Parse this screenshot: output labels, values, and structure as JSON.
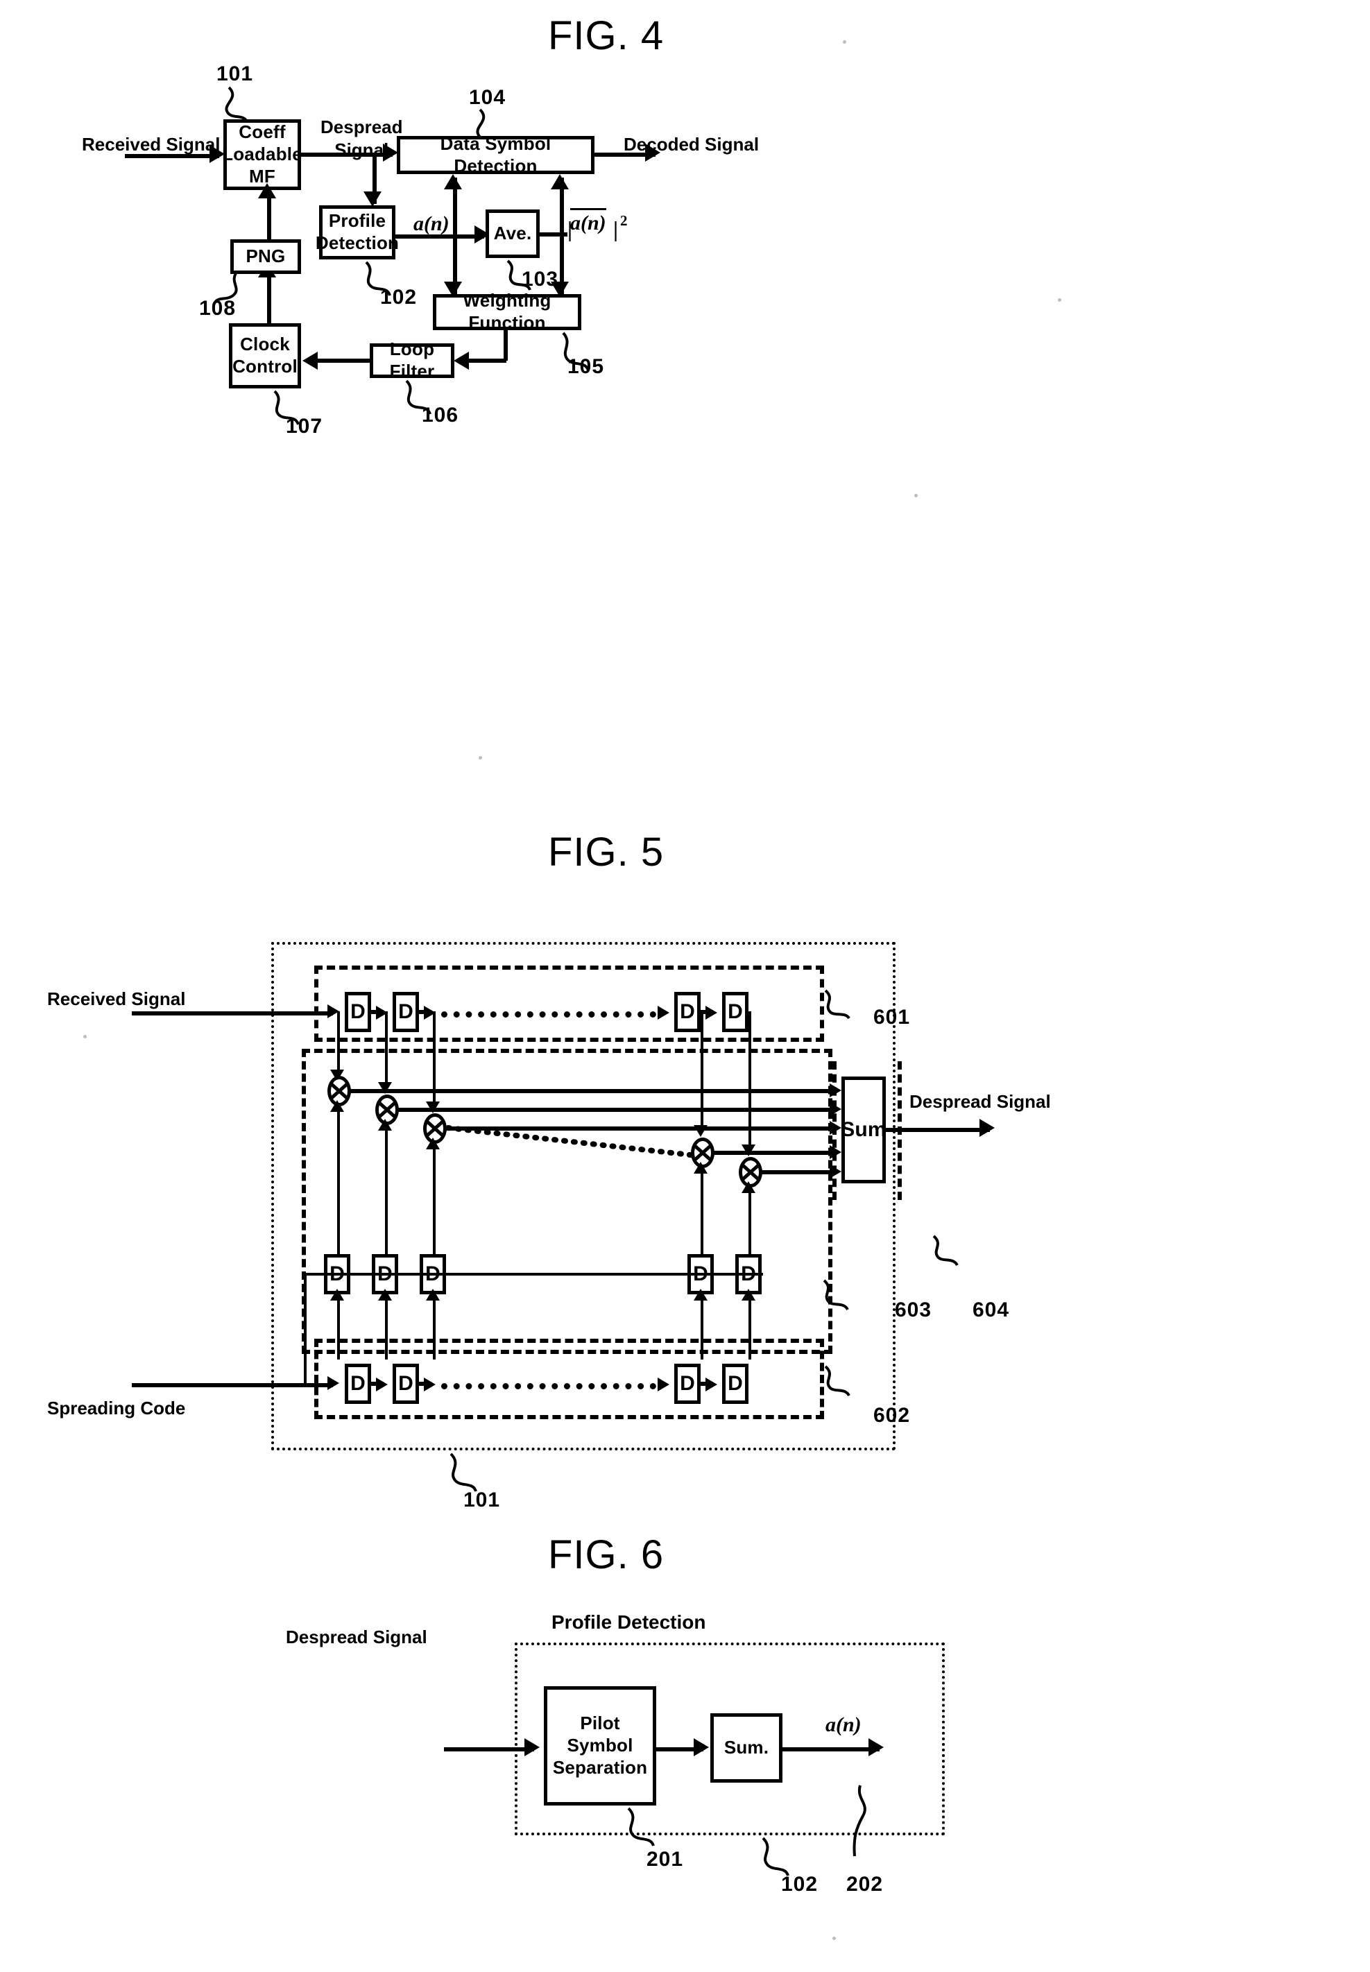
{
  "figures": [
    {
      "id": "fig4",
      "title": "FIG. 4",
      "blocks": [
        {
          "key": "coeff_mf",
          "label": "Coeff\nLoadable\nMF",
          "ref": "101"
        },
        {
          "key": "profile_det",
          "label": "Profile\nDetection",
          "ref": "102"
        },
        {
          "key": "ave",
          "label": "Ave.",
          "ref": "103"
        },
        {
          "key": "data_sym",
          "label": "Data Symbol Detection",
          "ref": "104"
        },
        {
          "key": "weighting",
          "label": "Weighting Function",
          "ref": "105"
        },
        {
          "key": "loop_filter",
          "label": "Loop Filter",
          "ref": "106"
        },
        {
          "key": "clock_ctrl",
          "label": "Clock\nControl",
          "ref": "107"
        },
        {
          "key": "png",
          "label": "PNG",
          "ref": "108"
        }
      ],
      "signals": {
        "received": "Received Signal",
        "despread": "Despread\nSignal",
        "decoded": "Decoded Signal",
        "a_of_n": "a(n)",
        "mag_sq": "|a(n)|",
        "mag_sq_exp": "2"
      }
    },
    {
      "id": "fig5",
      "title": "FIG. 5",
      "signals": {
        "received": "Received Signal",
        "spreading": "Spreading Code",
        "despread": "Despread Signal"
      },
      "blocks": [
        {
          "key": "sum",
          "label": "Sum"
        }
      ],
      "register_label": "D",
      "top_register_count": 4,
      "mid_register_count": 5,
      "bottom_register_count": 4,
      "multiplier_count": 5,
      "refs": [
        "601",
        "602",
        "603",
        "604",
        "101"
      ]
    },
    {
      "id": "fig6",
      "title": "FIG. 6",
      "container_label": "Profile Detection",
      "signals": {
        "despread": "Despread Signal",
        "a_of_n": "a(n)"
      },
      "blocks": [
        {
          "key": "pilot_sep",
          "label": "Pilot\nSymbol\nSeparation",
          "ref": "201"
        },
        {
          "key": "sum",
          "label": "Sum.",
          "ref": "202"
        }
      ],
      "refs": [
        "201",
        "102",
        "202"
      ]
    }
  ],
  "fig4": {
    "title": "FIG. 4",
    "coeff_mf_label": "Coeff\nLoadable\nMF",
    "profile_det_label": "Profile\nDetection",
    "ave_label": "Ave.",
    "data_sym_label": "Data Symbol Detection",
    "weighting_label": "Weighting Function",
    "loop_filter_label": "Loop Filter",
    "clock_ctrl_label": "Clock\nControl",
    "png_label": "PNG",
    "received_signal": "Received Signal",
    "despread_signal": "Despread\nSignal",
    "decoded_signal": "Decoded Signal",
    "a_n": "a(n)",
    "ref_101": "101",
    "ref_102": "102",
    "ref_103": "103",
    "ref_104": "104",
    "ref_105": "105",
    "ref_106": "106",
    "ref_107": "107",
    "ref_108": "108"
  },
  "fig5": {
    "title": "FIG. 5",
    "received_signal": "Received Signal",
    "spreading_code": "Spreading Code",
    "despread_signal": "Despread Signal",
    "sum_label": "Sum",
    "d_label": "D",
    "ref_601": "601",
    "ref_602": "602",
    "ref_603": "603",
    "ref_604": "604",
    "ref_101": "101"
  },
  "fig6": {
    "title": "FIG. 6",
    "profile_detection_label": "Profile Detection",
    "despread_signal": "Despread Signal",
    "pilot_sep_label": "Pilot\nSymbol\nSeparation",
    "sum_label": "Sum.",
    "a_n": "a(n)",
    "ref_201": "201",
    "ref_102": "102",
    "ref_202": "202"
  }
}
